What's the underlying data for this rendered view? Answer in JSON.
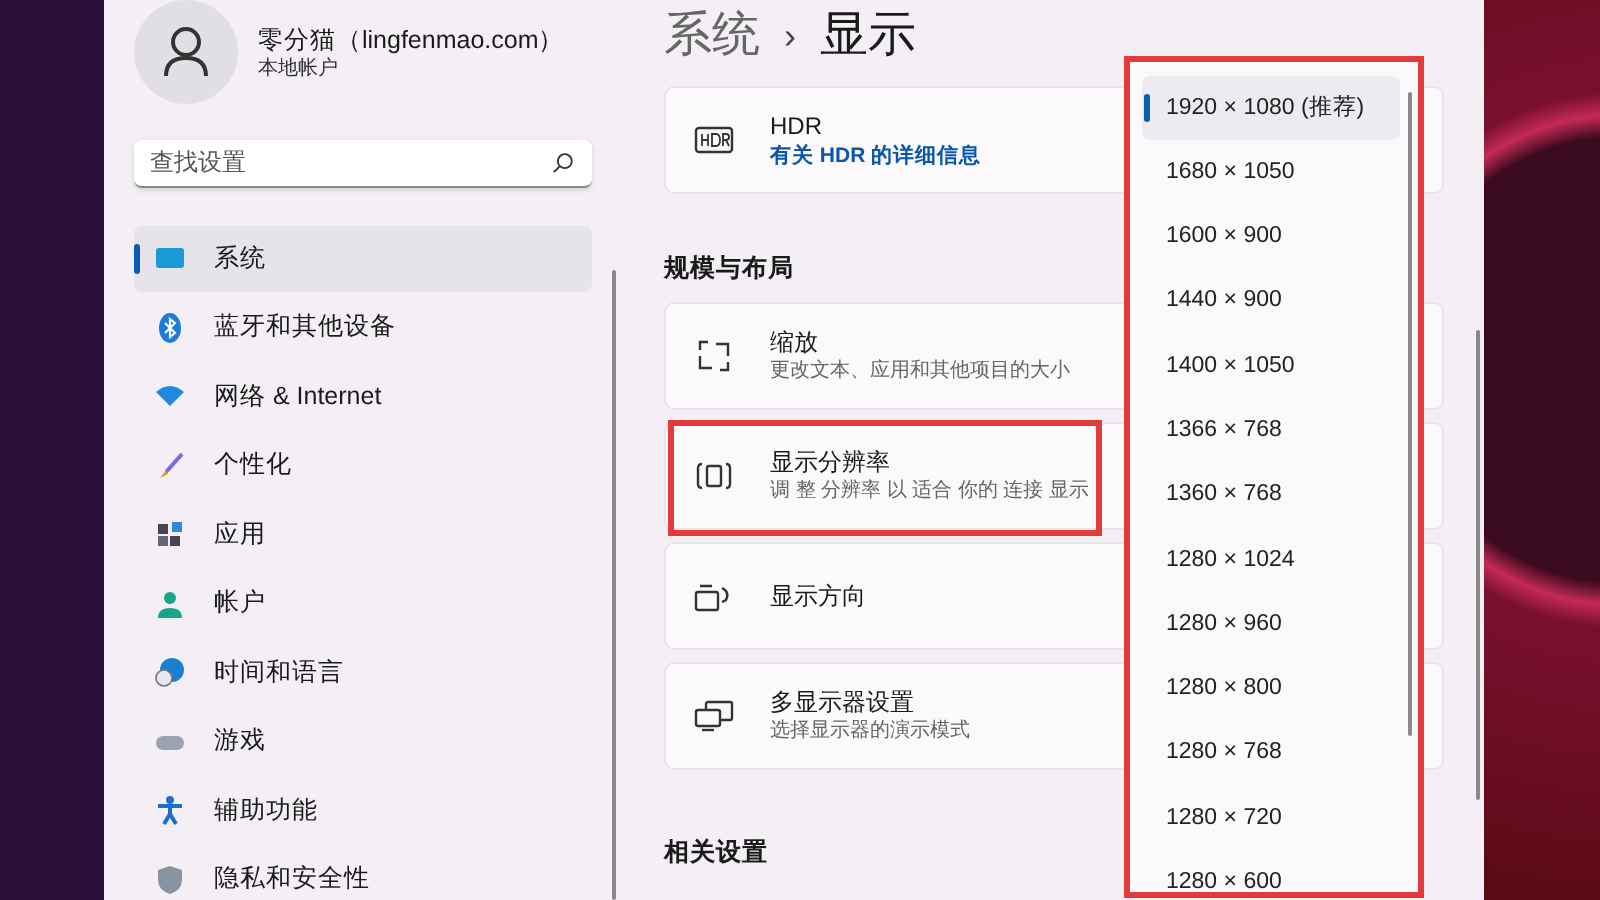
{
  "account": {
    "name": "零分猫（lingfenmao.com）",
    "type": "本地帐户"
  },
  "search": {
    "placeholder": "查找设置"
  },
  "sidebar": {
    "items": [
      {
        "label": "系统",
        "kind": "system",
        "selected": true
      },
      {
        "label": "蓝牙和其他设备",
        "kind": "bluetooth",
        "selected": false
      },
      {
        "label": "网络 & Internet",
        "kind": "network",
        "selected": false
      },
      {
        "label": "个性化",
        "kind": "brush",
        "selected": false
      },
      {
        "label": "应用",
        "kind": "apps",
        "selected": false
      },
      {
        "label": "帐户",
        "kind": "account",
        "selected": false
      },
      {
        "label": "时间和语言",
        "kind": "time",
        "selected": false
      },
      {
        "label": "游戏",
        "kind": "game",
        "selected": false
      },
      {
        "label": "辅助功能",
        "kind": "accessibility",
        "selected": false
      },
      {
        "label": "隐私和安全性",
        "kind": "shield",
        "selected": false
      }
    ]
  },
  "breadcrumb": {
    "parent": "系统",
    "separator": "›",
    "current": "显示"
  },
  "sections": [
    {
      "cards": [
        {
          "kind": "hdr",
          "title": "HDR",
          "link": "有关 HDR 的详细信息",
          "highlighted": false
        }
      ]
    },
    {
      "heading": "规模与布局",
      "cards": [
        {
          "kind": "scale",
          "title": "缩放",
          "subtitle": "更改文本、应用和其他项目的大小",
          "highlighted": false
        },
        {
          "kind": "resolution",
          "title": "显示分辨率",
          "subtitle": "调 整 分辨率 以 适合 你的 连接 显示",
          "highlighted": true
        },
        {
          "kind": "orientation",
          "title": "显示方向",
          "highlighted": false
        },
        {
          "kind": "multi",
          "title": "多显示器设置",
          "subtitle": "选择显示器的演示模式",
          "highlighted": false
        }
      ]
    },
    {
      "heading": "相关设置"
    }
  ],
  "resolution_dropdown": {
    "highlighted": true,
    "options": [
      {
        "label": "1920 × 1080 (推荐)",
        "selected": true
      },
      {
        "label": "1680 × 1050",
        "selected": false
      },
      {
        "label": "1600 × 900",
        "selected": false
      },
      {
        "label": "1440 × 900",
        "selected": false
      },
      {
        "label": "1400 × 1050",
        "selected": false
      },
      {
        "label": "1366 × 768",
        "selected": false
      },
      {
        "label": "1360 × 768",
        "selected": false
      },
      {
        "label": "1280 × 1024",
        "selected": false
      },
      {
        "label": "1280 × 960",
        "selected": false
      },
      {
        "label": "1280 × 800",
        "selected": false
      },
      {
        "label": "1280 × 768",
        "selected": false
      },
      {
        "label": "1280 × 720",
        "selected": false
      },
      {
        "label": "1280 × 600",
        "selected": false
      }
    ]
  }
}
